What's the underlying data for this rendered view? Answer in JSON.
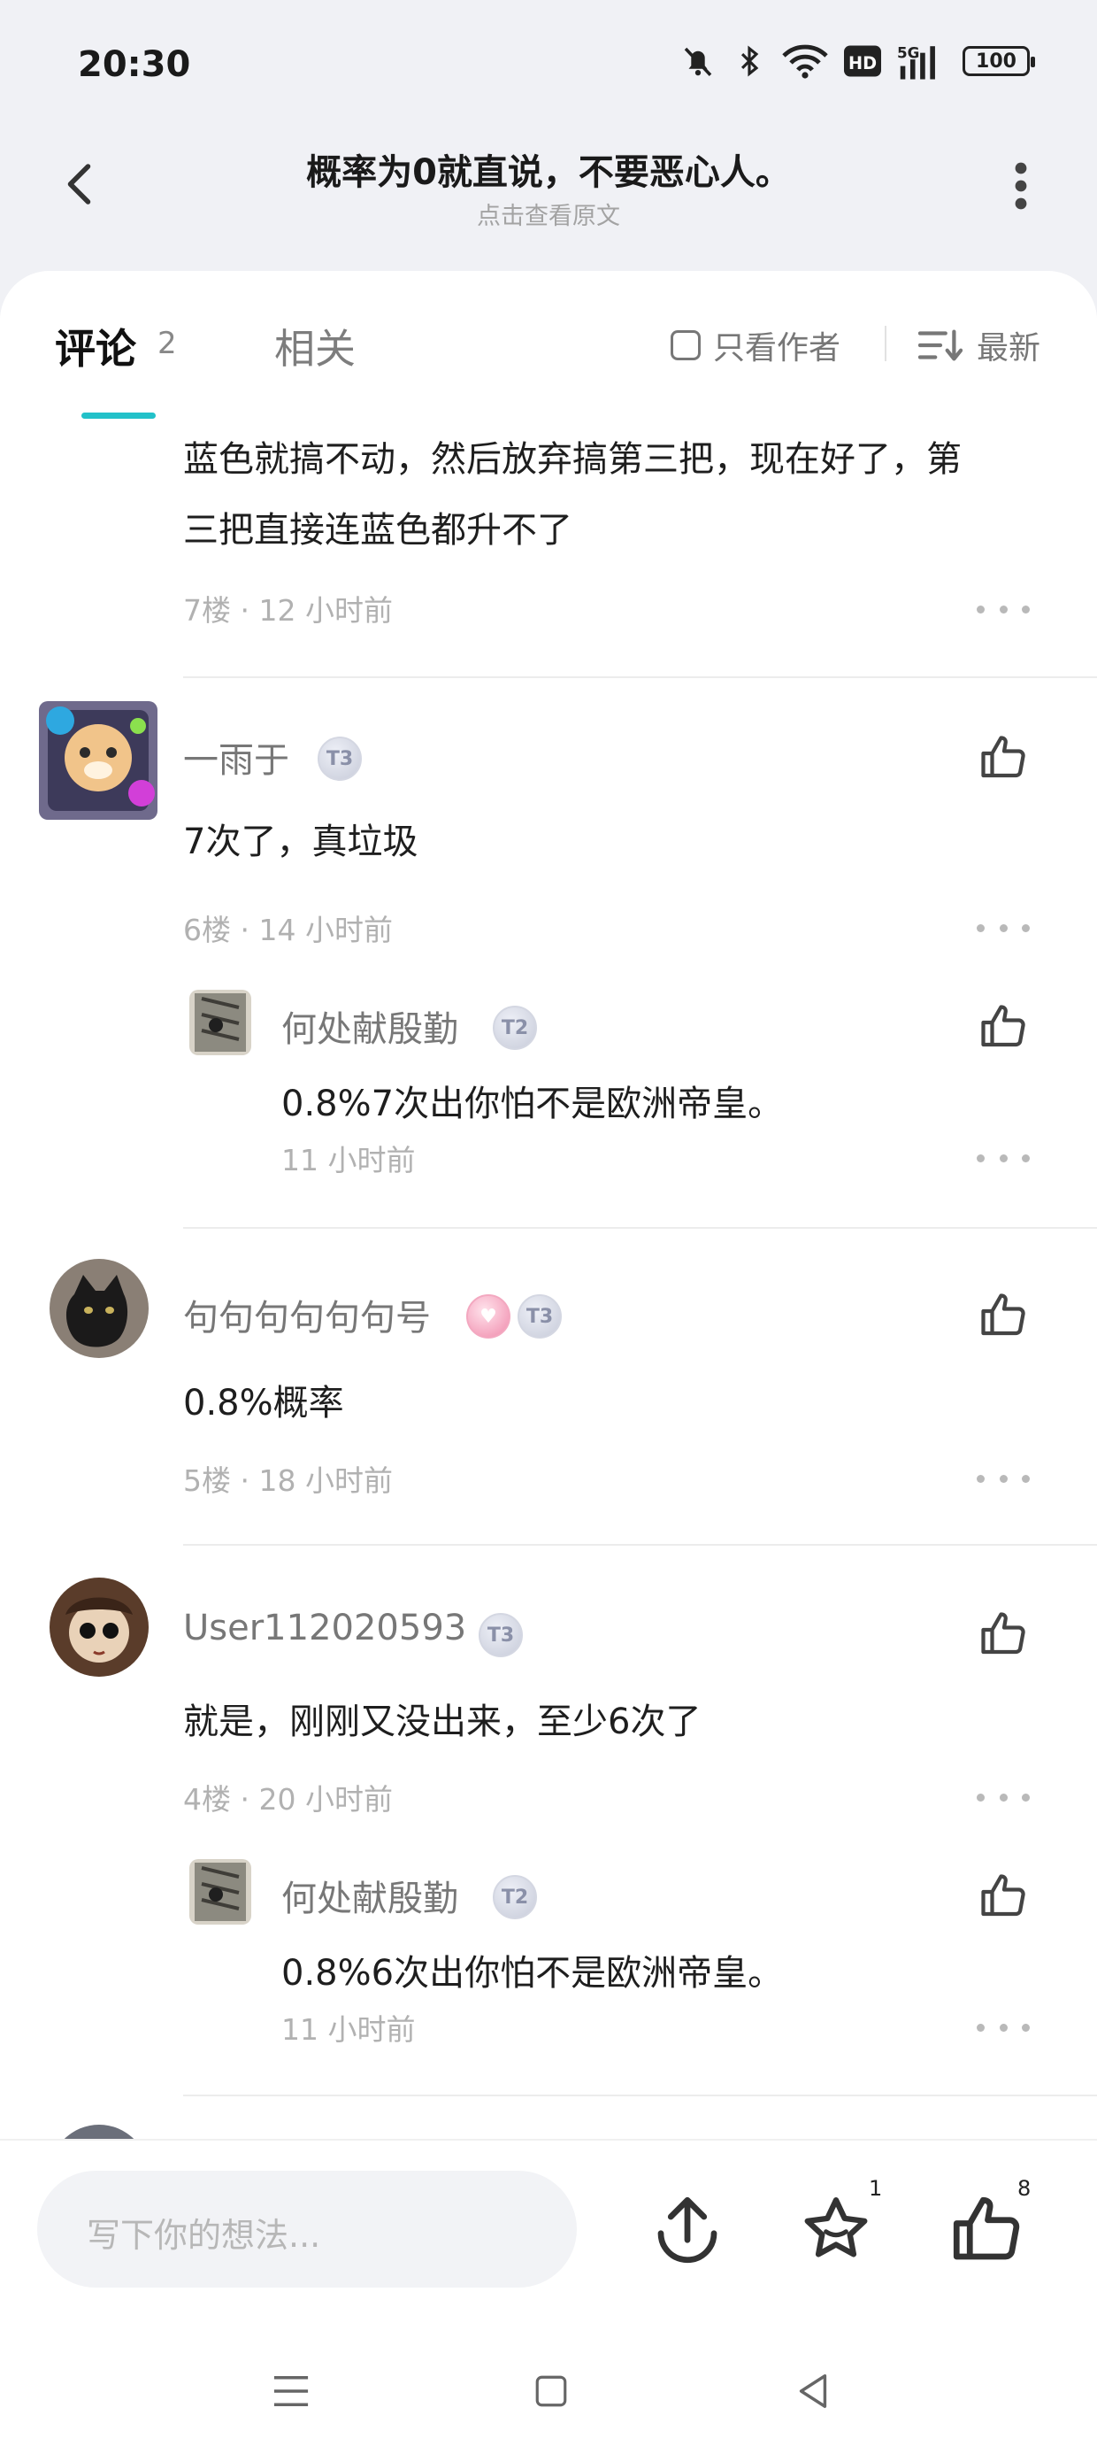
{
  "status_bar": {
    "time": "20:30",
    "battery": "100",
    "network": "5G"
  },
  "header": {
    "title": "概率为0就直说，不要恶心人。",
    "subtitle": "点击查看原文"
  },
  "tabs": {
    "comments_label": "评论",
    "comments_count": "2",
    "related_label": "相关",
    "only_author_label": "只看作者",
    "sort_label": "最新"
  },
  "comments": [
    {
      "text_lines": [
        "蓝色就搞不动，然后放弃搞第三把，现在好了，第",
        "三把直接连蓝色都升不了"
      ],
      "meta": "7楼 · 12 小时前"
    },
    {
      "username": "一雨于",
      "badge": "T3",
      "text": "7次了，真垃圾",
      "meta": "6楼 · 14 小时前",
      "reply": {
        "username": "何处献殷勤",
        "badge": "T2",
        "text": "0.8%7次出你怕不是欧洲帝皇。",
        "meta": "11 小时前"
      }
    },
    {
      "username": "句句句句句句号",
      "badge": "T3",
      "text": "0.8%概率",
      "meta": "5楼 · 18 小时前"
    },
    {
      "username": "User112020593",
      "badge": "T3",
      "text": "就是，刚刚又没出来，至少6次了",
      "meta": "4楼 · 20 小时前",
      "reply": {
        "username": "何处献殷勤",
        "badge": "T2",
        "text": "0.8%6次出你怕不是欧洲帝皇。",
        "meta": "11 小时前"
      }
    }
  ],
  "bottom_bar": {
    "input_placeholder": "写下你的想法...",
    "favorite_count": "1",
    "like_count": "8"
  },
  "colors": {
    "accent": "#22c1c9",
    "background": "#f0f1f5",
    "card": "#ffffff"
  }
}
